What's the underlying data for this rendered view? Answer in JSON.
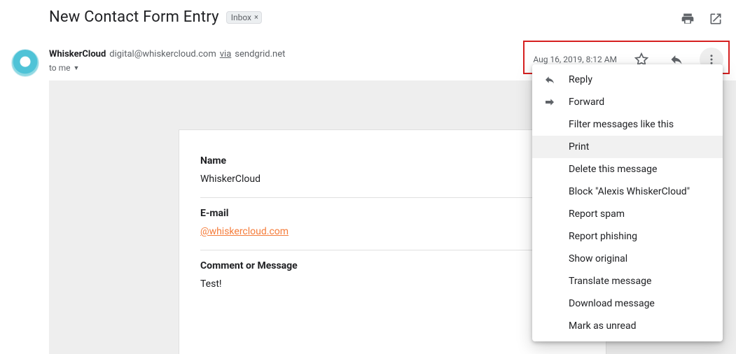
{
  "subject": "New Contact Form Entry",
  "label": {
    "name": "Inbox"
  },
  "sender": {
    "display_name": "WhiskerCloud",
    "email": "digital@whiskercloud.com",
    "via_label": "via",
    "via_domain": "sendgrid.net"
  },
  "recipient_summary": "to me",
  "timestamp": "Aug 16, 2019, 8:12 AM",
  "body_fields": {
    "name": {
      "label": "Name",
      "value": "WhiskerCloud"
    },
    "email": {
      "label": "E-mail",
      "value": "@whiskercloud.com"
    },
    "comment": {
      "label": "Comment or Message",
      "value": "Test!"
    }
  },
  "menu": {
    "items": [
      {
        "icon": "reply",
        "label": "Reply"
      },
      {
        "icon": "forward",
        "label": "Forward"
      },
      {
        "icon": "",
        "label": "Filter messages like this"
      },
      {
        "icon": "",
        "label": "Print"
      },
      {
        "icon": "",
        "label": "Delete this message"
      },
      {
        "icon": "",
        "label": "Block \"Alexis WhiskerCloud\""
      },
      {
        "icon": "",
        "label": "Report spam"
      },
      {
        "icon": "",
        "label": "Report phishing"
      },
      {
        "icon": "",
        "label": "Show original"
      },
      {
        "icon": "",
        "label": "Translate message"
      },
      {
        "icon": "",
        "label": "Download message"
      },
      {
        "icon": "",
        "label": "Mark as unread"
      }
    ],
    "highlight_index": 3
  }
}
